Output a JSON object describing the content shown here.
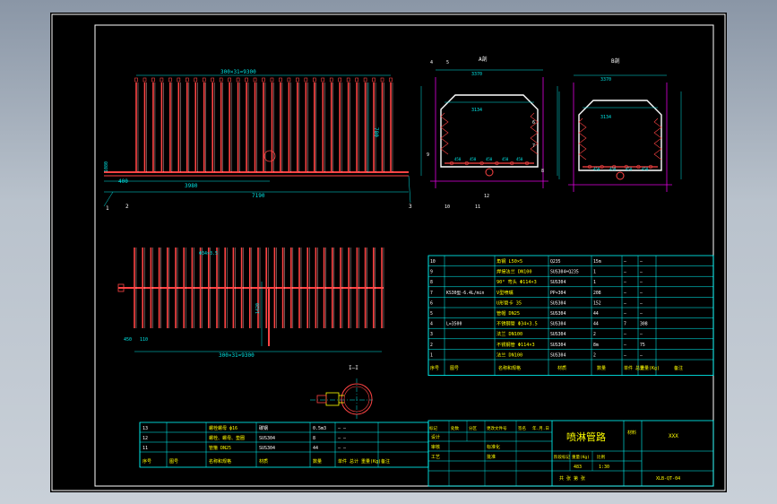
{
  "colors": {
    "background": "#000000",
    "frame": "#ffffff",
    "pipe": "#ff4444",
    "dimension": "#00e5e5",
    "section": "#e000e0",
    "text_yellow": "#ffff00",
    "table": "#00ffff",
    "text_white": "#ffffff"
  },
  "top_view": {
    "dim_overall": "300×31=9300",
    "dim_left": "400",
    "dim_mid": "3980",
    "dim_total": "7190",
    "dim_height": "780",
    "dim_small": "1080",
    "callouts": [
      "1",
      "2",
      "3"
    ]
  },
  "front_view": {
    "dim_overall": "300×31=9300",
    "dim_left": "450",
    "dim_small": "110",
    "dim_post": "1420",
    "callout": "Φ34×3.5"
  },
  "detail": {
    "label": "I—I"
  },
  "section_a": {
    "title": "A剖",
    "dims": [
      "3370",
      "3134",
      "450",
      "450",
      "450",
      "450",
      "450"
    ],
    "callouts": [
      "4",
      "5",
      "6",
      "7",
      "8",
      "9",
      "10",
      "11",
      "12"
    ]
  },
  "section_b": {
    "title": "B剖",
    "dims": [
      "3370",
      "3134",
      "450",
      "450",
      "450",
      "450"
    ]
  },
  "parts_table": {
    "headers": [
      "序号",
      "图号",
      "名称和规格",
      "材质",
      "数量",
      "单件 总计",
      "重量(Kg)",
      "备注"
    ],
    "rows": [
      [
        "10",
        "",
        "角钢 L50×5",
        "Q235",
        "15m",
        "—",
        "—",
        ""
      ],
      [
        "9",
        "",
        "焊接法兰 DN100",
        "SUS304+Q235",
        "1",
        "—",
        "—",
        ""
      ],
      [
        "8",
        "",
        "90° 弯头 Φ114×3",
        "SUS304",
        "1",
        "—",
        "—",
        ""
      ],
      [
        "7",
        "KS30型-6.4L/min",
        "V型喷嘴",
        "PP+304",
        "208",
        "—",
        "—",
        ""
      ],
      [
        "6",
        "",
        "U形管卡 35",
        "SUS304",
        "152",
        "—",
        "—",
        ""
      ],
      [
        "5",
        "",
        "管帽 DN25",
        "SUS304",
        "44",
        "—",
        "—",
        ""
      ],
      [
        "4",
        "L=3500",
        "不锈钢管 Φ34×3.5",
        "SUS304",
        "44",
        "7",
        "308",
        ""
      ],
      [
        "3",
        "",
        "法兰 DN100",
        "SUS304",
        "2",
        "—",
        "—",
        ""
      ],
      [
        "2",
        "",
        "不锈钢管 Φ114×3",
        "SUS304",
        "8m",
        "—",
        "75",
        ""
      ],
      [
        "1",
        "",
        "法兰 DN100",
        "SUS304",
        "2",
        "—",
        "—",
        ""
      ]
    ]
  },
  "small_table": {
    "rows": [
      [
        "13",
        "",
        "螺栓螺母 ф16",
        "碳钢",
        "0.5m3",
        "—",
        "—",
        ""
      ],
      [
        "12",
        "",
        "螺栓、螺母、垫圈",
        "SUS304",
        "8",
        "—",
        "—",
        ""
      ],
      [
        "11",
        "",
        "管箍 DN25",
        "SUS304",
        "44",
        "—",
        "—",
        ""
      ]
    ],
    "headers": [
      "序号",
      "图号",
      "名称和规格",
      "材质",
      "数量",
      "单件 总计 重量(Kg)",
      "备注"
    ]
  },
  "title_block": {
    "drawing_title": "喷淋管路",
    "col_labels": [
      "标记",
      "处数",
      "分区",
      "更改文件号",
      "签名",
      "年.月.日"
    ],
    "rows": [
      "设计",
      "审核",
      "工艺",
      "标准化",
      "批准"
    ],
    "stage_headers": [
      "阶段标记",
      "重量(Kg)",
      "比例"
    ],
    "weight": "483",
    "scale": "1:30",
    "sheet": "共  张  第  张",
    "company": "XXX",
    "drawing_no": "XLB-QT-04",
    "side_label": "材料"
  }
}
